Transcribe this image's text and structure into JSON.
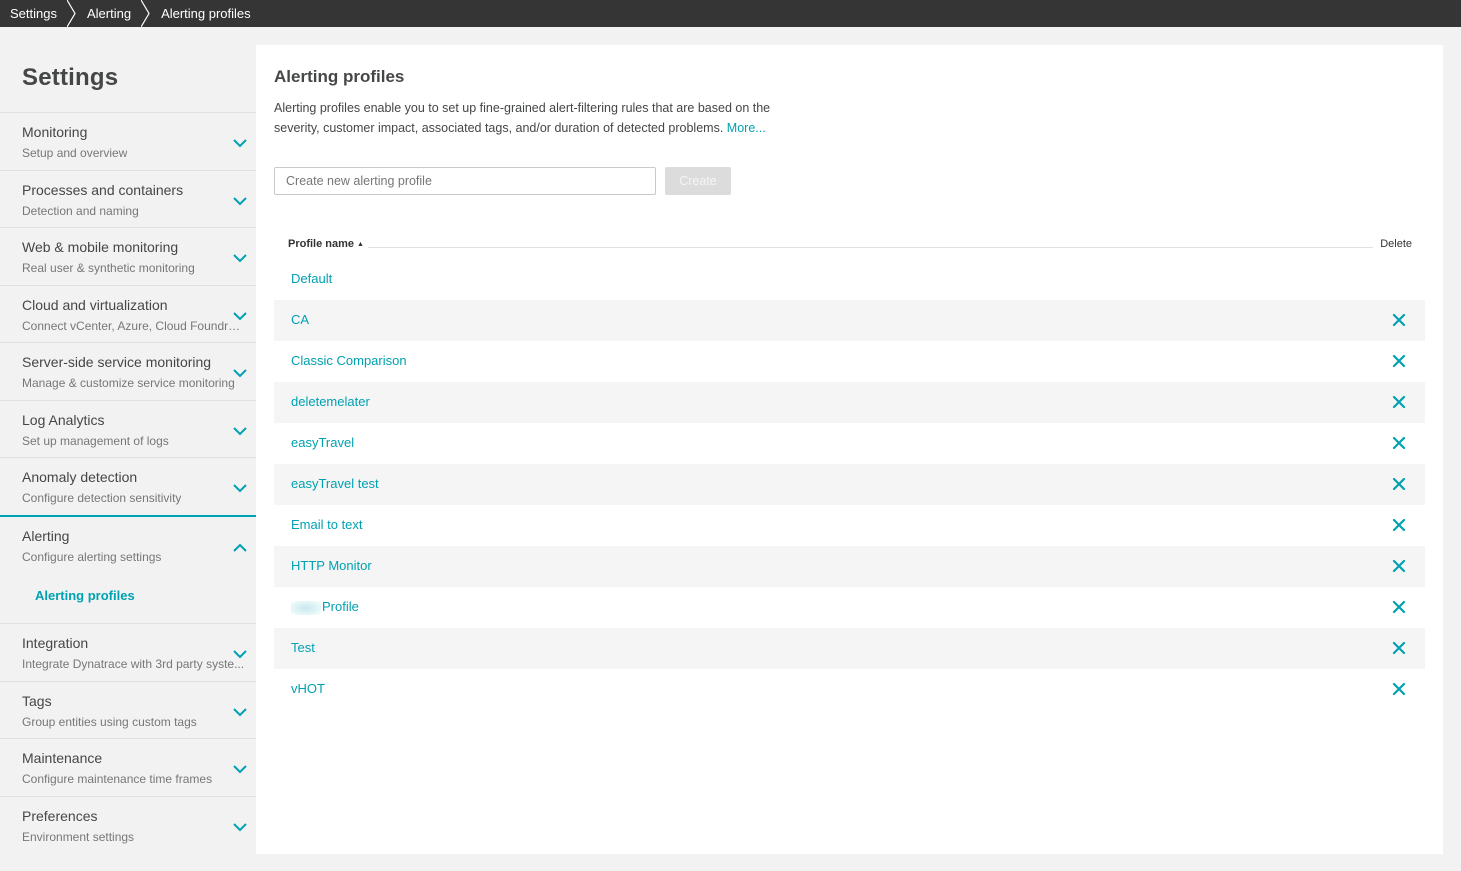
{
  "breadcrumb": {
    "items": [
      "Settings",
      "Alerting",
      "Alerting profiles"
    ]
  },
  "sidebar": {
    "title": "Settings",
    "items": [
      {
        "title": "Monitoring",
        "subtitle": "Setup and overview",
        "expanded": false
      },
      {
        "title": "Processes and containers",
        "subtitle": "Detection and naming",
        "expanded": false
      },
      {
        "title": "Web & mobile monitoring",
        "subtitle": "Real user & synthetic monitoring",
        "expanded": false
      },
      {
        "title": "Cloud and virtualization",
        "subtitle": "Connect vCenter, Azure, Cloud Foundry o...",
        "expanded": false
      },
      {
        "title": "Server-side service monitoring",
        "subtitle": "Manage & customize service monitoring",
        "expanded": false
      },
      {
        "title": "Log Analytics",
        "subtitle": "Set up management of logs",
        "expanded": false
      },
      {
        "title": "Anomaly detection",
        "subtitle": "Configure detection sensitivity",
        "expanded": false
      },
      {
        "title": "Alerting",
        "subtitle": "Configure alerting settings",
        "expanded": true,
        "children": [
          "Alerting profiles"
        ]
      },
      {
        "title": "Integration",
        "subtitle": "Integrate Dynatrace with 3rd party syste...",
        "expanded": false
      },
      {
        "title": "Tags",
        "subtitle": "Group entities using custom tags",
        "expanded": false
      },
      {
        "title": "Maintenance",
        "subtitle": "Configure maintenance time frames",
        "expanded": false
      },
      {
        "title": "Preferences",
        "subtitle": "Environment settings",
        "expanded": false
      }
    ]
  },
  "main": {
    "title": "Alerting profiles",
    "description": "Alerting profiles enable you to set up fine-grained alert-filtering rules that are based on the severity, customer impact, associated tags, and/or duration of detected problems.",
    "more_link": "More...",
    "new_profile": {
      "placeholder": "Create new alerting profile",
      "value": "",
      "button_label": "Create",
      "button_enabled": false
    },
    "table": {
      "columns": [
        "Profile name",
        "Delete"
      ],
      "sort": "ascending",
      "rows": [
        {
          "name": "Default",
          "deletable": false
        },
        {
          "name": "CA",
          "deletable": true
        },
        {
          "name": "Classic Comparison",
          "deletable": true
        },
        {
          "name": "deletemelater",
          "deletable": true
        },
        {
          "name": "easyTravel",
          "deletable": true
        },
        {
          "name": "easyTravel test",
          "deletable": true
        },
        {
          "name": "Email to text",
          "deletable": true
        },
        {
          "name": "HTTP Monitor",
          "deletable": true
        },
        {
          "name": "Profile",
          "deletable": true,
          "redacted_prefix": true
        },
        {
          "name": "Test",
          "deletable": true
        },
        {
          "name": "vHOT",
          "deletable": true
        }
      ]
    }
  },
  "colors": {
    "accent": "#00a1b2",
    "topbar": "#353535",
    "sidebar_bg": "#f2f2f2",
    "text": "#454646"
  }
}
